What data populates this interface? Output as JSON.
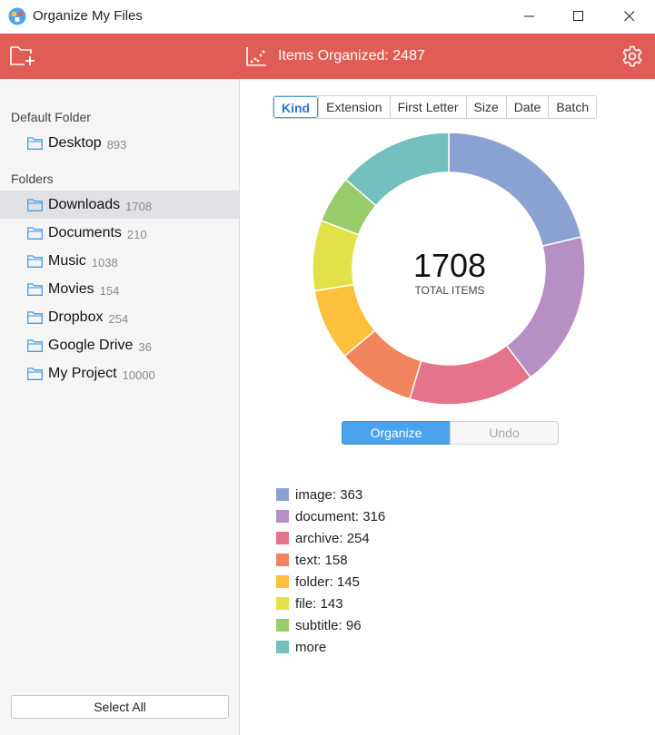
{
  "window": {
    "title": "Organize My Files"
  },
  "toolbar": {
    "stats_text": "Items Organized: 2487"
  },
  "sidebar": {
    "default_label": "Default Folder",
    "default_folder": {
      "name": "Desktop",
      "count": "893"
    },
    "folders_label": "Folders",
    "folders": [
      {
        "name": "Downloads",
        "count": "1708",
        "selected": true
      },
      {
        "name": "Documents",
        "count": "210"
      },
      {
        "name": "Music",
        "count": "1038"
      },
      {
        "name": "Movies",
        "count": "154"
      },
      {
        "name": "Dropbox",
        "count": "254"
      },
      {
        "name": "Google Drive",
        "count": "36"
      },
      {
        "name": "My Project",
        "count": "10000"
      }
    ],
    "select_all": "Select All"
  },
  "tabs": [
    {
      "label": "Kind",
      "active": true
    },
    {
      "label": "Extension"
    },
    {
      "label": "First Letter"
    },
    {
      "label": "Size"
    },
    {
      "label": "Date"
    },
    {
      "label": "Batch"
    }
  ],
  "summary": {
    "total": "1708",
    "total_label": "TOTAL ITEMS"
  },
  "actions": {
    "organize": "Organize",
    "undo": "Undo"
  },
  "chart_data": {
    "type": "pie",
    "categories": [
      "image",
      "document",
      "archive",
      "text",
      "folder",
      "file",
      "subtitle",
      "more"
    ],
    "values": [
      363,
      316,
      254,
      158,
      145,
      143,
      96,
      233
    ],
    "colors": [
      "#8aa2d2",
      "#b690c4",
      "#e5748a",
      "#f1845c",
      "#fdc03c",
      "#e2e149",
      "#99cc6b",
      "#73bfbe"
    ]
  },
  "legend": [
    {
      "label": "image: 363",
      "color": "#8aa2d2"
    },
    {
      "label": "document: 316",
      "color": "#b690c4"
    },
    {
      "label": "archive: 254",
      "color": "#e5748a"
    },
    {
      "label": "text: 158",
      "color": "#f1845c"
    },
    {
      "label": "folder: 145",
      "color": "#fdc03c"
    },
    {
      "label": "file: 143",
      "color": "#e2e149"
    },
    {
      "label": "subtitle: 96",
      "color": "#99cc6b"
    },
    {
      "label": "more",
      "color": "#73bfbe"
    }
  ]
}
